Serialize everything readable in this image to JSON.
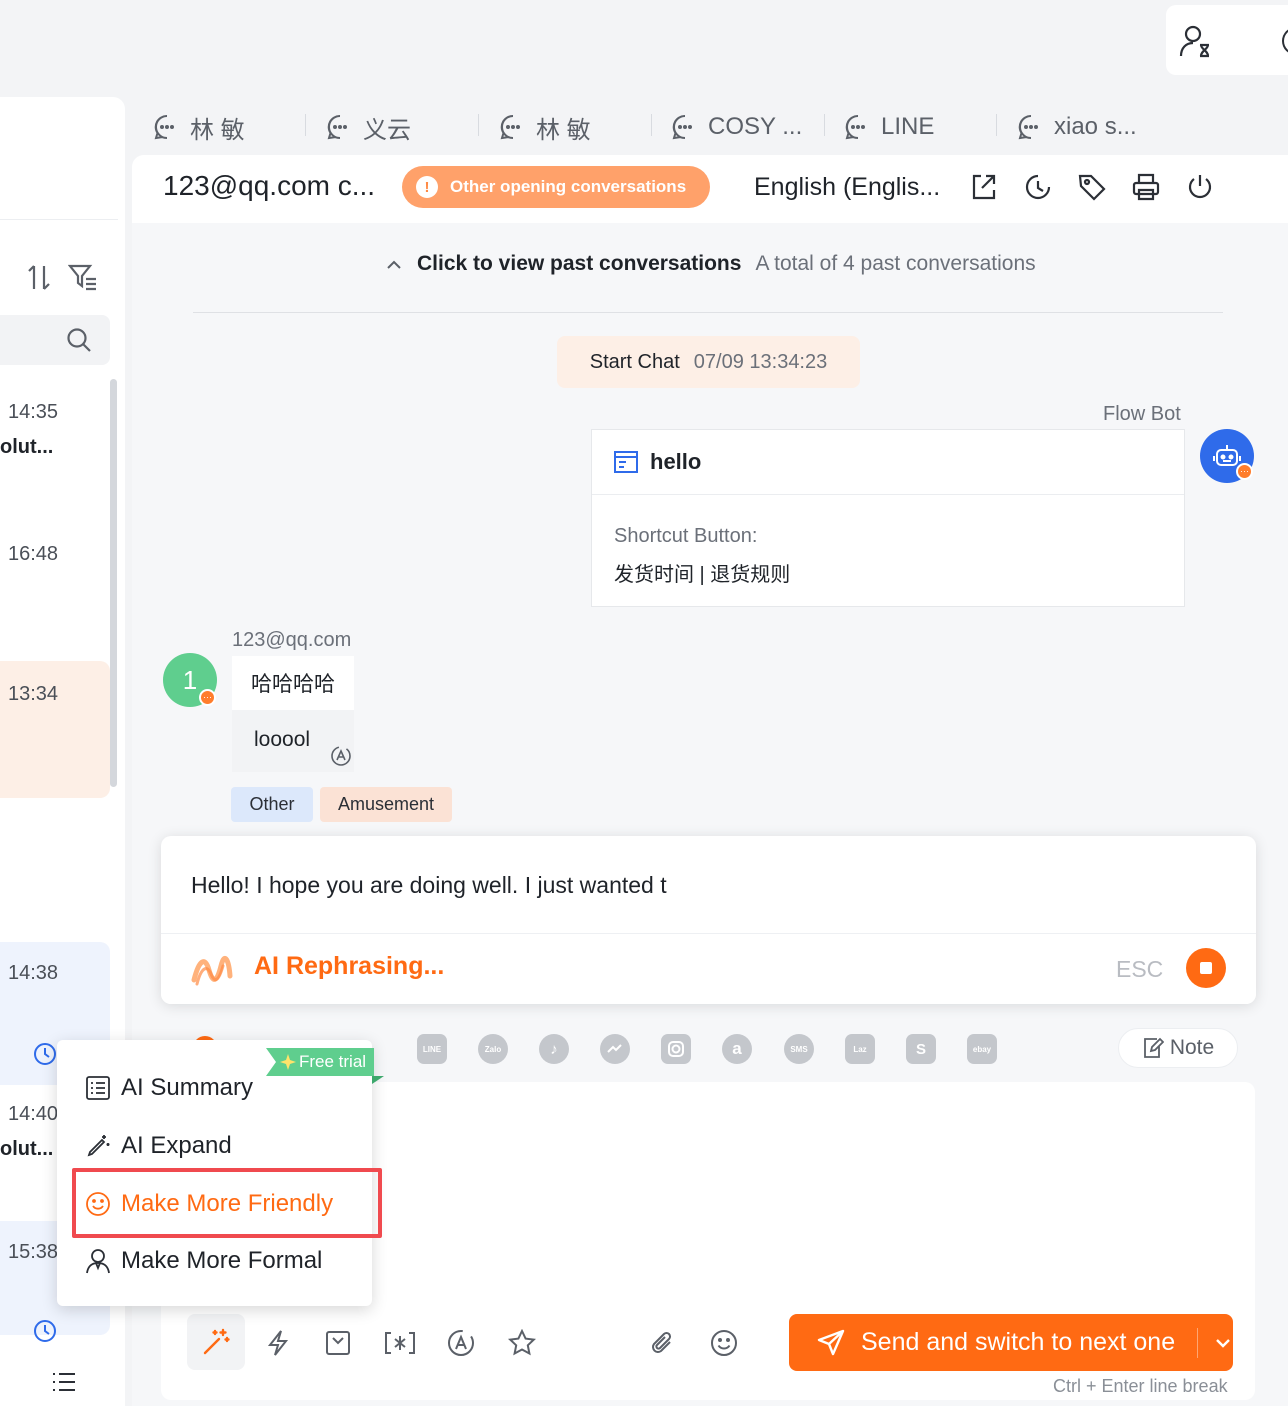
{
  "left_list": {
    "items": [
      {
        "time": "14:35",
        "preview": "olut..."
      },
      {
        "time": "16:48",
        "preview": ""
      },
      {
        "time": "13:34",
        "preview": ""
      },
      {
        "time": "14:38",
        "preview": ""
      },
      {
        "time": "14:40",
        "preview": "olut..."
      },
      {
        "time": "15:38",
        "preview": ""
      }
    ]
  },
  "tabs": [
    {
      "label": "林 敏"
    },
    {
      "label": "义云"
    },
    {
      "label": "林 敏"
    },
    {
      "label": "COSY ..."
    },
    {
      "label": "LINE"
    },
    {
      "label": "xiao s..."
    }
  ],
  "header": {
    "title": "123@qq.com c...",
    "alert_pill": "Other opening conversations",
    "alert_glyph": "!",
    "language": "English (Englis..."
  },
  "history": {
    "link": "Click to view past conversations",
    "count": "A total of 4 past conversations"
  },
  "start_chat": {
    "label": "Start Chat",
    "time": "07/09 13:34:23"
  },
  "bot": {
    "name": "Flow Bot",
    "message_title": "hello",
    "shortcut_label": "Shortcut Button:",
    "shortcut_value": "发货时间 | 退货规则"
  },
  "customer": {
    "name": "123@qq.com",
    "avatar_initial": "1",
    "message_1": "哈哈哈哈",
    "message_2": "looool",
    "tags": [
      "Other",
      "Amusement"
    ]
  },
  "ai_rephrase": {
    "draft_text": "Hello! I hope you are doing well. I just wanted t",
    "status": "AI Rephrasing...",
    "esc_hint": "ESC"
  },
  "channels": [
    "LINE",
    "Zalo",
    "TikTok",
    "Messenger",
    "Instagram",
    "Amazon",
    "SMS",
    "Laz",
    "Shopify",
    "ebay"
  ],
  "note_label": "Note",
  "ai_menu": {
    "badge": "Free trial",
    "items": [
      {
        "label": "AI Summary",
        "icon": "list-icon"
      },
      {
        "label": "AI Expand",
        "icon": "magic-pen-icon"
      },
      {
        "label": "Make More Friendly",
        "icon": "smile-icon"
      },
      {
        "label": "Make More Formal",
        "icon": "person-icon"
      }
    ],
    "selected_index": 2
  },
  "composer": {
    "send_label": "Send and switch to next one",
    "hint": "Ctrl + Enter line break"
  },
  "colors": {
    "accent": "#ff6a13",
    "pill": "#ffa16a",
    "green": "#5fce8e",
    "bot_blue": "#2f6bea",
    "highlight": "#f04a4f"
  }
}
